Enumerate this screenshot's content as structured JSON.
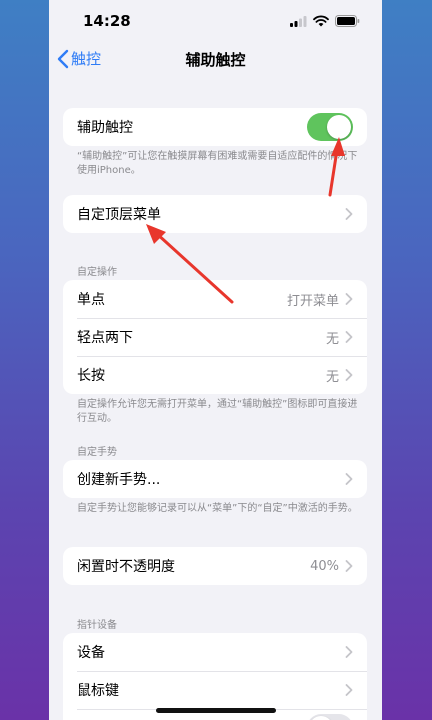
{
  "status_bar": {
    "time": "14:28"
  },
  "nav": {
    "back_label": "触控",
    "title": "辅助触控"
  },
  "assistive_touch": {
    "label": "辅助触控",
    "enabled": true,
    "footnote": "“辅助触控”可让您在触摸屏幕有困难或需要自适应配件的情况下使用iPhone。"
  },
  "custom_menu": {
    "label": "自定顶层菜单"
  },
  "custom_actions": {
    "header": "自定操作",
    "items": [
      {
        "label": "单点",
        "value": "打开菜单"
      },
      {
        "label": "轻点两下",
        "value": "无"
      },
      {
        "label": "长按",
        "value": "无"
      }
    ],
    "footnote": "自定操作允许您无需打开菜单，通过“辅助触控”图标即可直接进行互动。"
  },
  "custom_gestures": {
    "header": "自定手势",
    "create_label": "创建新手势...",
    "footnote": "自定手势让您能够记录可以从“菜单”下的“自定”中激活的手势。"
  },
  "idle_opacity": {
    "label": "闲置时不透明度",
    "value": "40%"
  },
  "pointer_devices": {
    "header": "指针设备",
    "items": [
      {
        "label": "设备"
      },
      {
        "label": "鼠标键"
      }
    ]
  },
  "icons": [
    "back-chevron-icon",
    "signal-icon",
    "wifi-icon",
    "battery-icon",
    "chevron-right-icon",
    "red-arrow-annotation"
  ],
  "colors": {
    "accent_blue": "#2f7cf6",
    "toggle_green": "#5fc45d",
    "annotation_red": "#e8362c",
    "background_gray": "#f2f2f7"
  }
}
